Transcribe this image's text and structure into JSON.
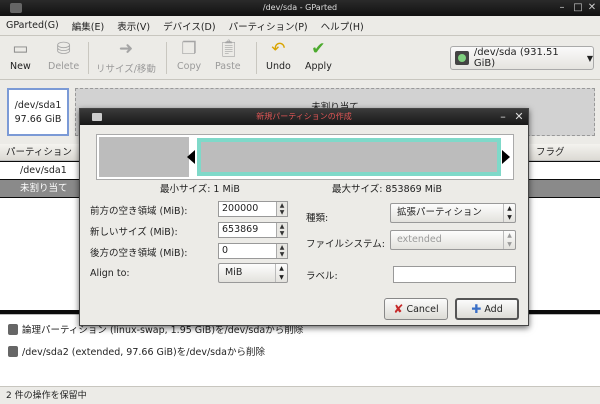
{
  "window": {
    "title": "/dev/sda - GParted"
  },
  "menu": [
    "GParted(G)",
    "編集(E)",
    "表示(V)",
    "デバイス(D)",
    "パーティション(P)",
    "ヘルプ(H)"
  ],
  "toolbar": {
    "new": "New",
    "delete": "Delete",
    "resize": "リサイズ/移動",
    "copy": "Copy",
    "paste": "Paste",
    "undo": "Undo",
    "apply": "Apply"
  },
  "device": {
    "label": "/dev/sda (931.51 GiB)"
  },
  "graph": {
    "part1_name": "/dev/sda1",
    "part1_size": "97.66 GiB",
    "unalloc": "未割り当て"
  },
  "columns": {
    "partition": "パーティション",
    "flags": "フラグ"
  },
  "rows": [
    "/dev/sda1",
    "未割り当て"
  ],
  "dialog": {
    "title": "新規パーティションの作成",
    "min_size": "最小サイズ: 1 MiB",
    "max_size": "最大サイズ: 853869 MiB",
    "free_before_label": "前方の空き領域 (MiB):",
    "free_before_value": "200000",
    "new_size_label": "新しいサイズ (MiB):",
    "new_size_value": "653869",
    "free_after_label": "後方の空き領域 (MiB):",
    "free_after_value": "0",
    "align_label": "Align to:",
    "align_value": "MiB",
    "type_label": "種類:",
    "type_value": "拡張パーティション",
    "fs_label": "ファイルシステム:",
    "fs_value": "extended",
    "label_label": "ラベル:",
    "cancel": "Cancel",
    "add": "Add",
    "accent_color": "#7fd9c9"
  },
  "pending": [
    "論理パーティション (linux-swap, 1.95 GiB)を/dev/sdaから削除",
    "/dev/sda2 (extended, 97.66 GiB)を/dev/sdaから削除"
  ],
  "status": "2 件の操作を保留中"
}
